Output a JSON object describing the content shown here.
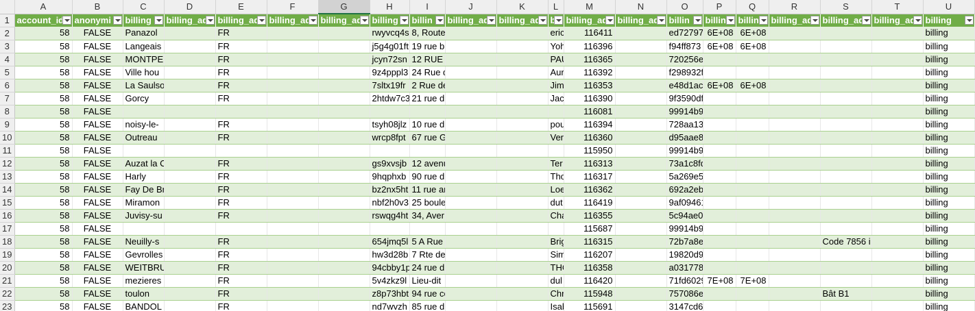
{
  "column_letters": [
    "A",
    "B",
    "C",
    "D",
    "E",
    "F",
    "G",
    "H",
    "I",
    "J",
    "K",
    "L",
    "M",
    "N",
    "O",
    "P",
    "Q",
    "R",
    "S",
    "T",
    "U"
  ],
  "selected_column": "G",
  "header_row_number": "1",
  "headers": [
    "account_id",
    "anonymi",
    "billing",
    "billing_ad",
    "billing_ad",
    "billing_ad",
    "billing_ad",
    "billing",
    "billin",
    "billing_ad",
    "billing_ad",
    "b",
    "billing_ad",
    "billing_ad",
    "billin",
    "billin",
    "billin",
    "billing_ad",
    "billing_ad",
    "billing_ad",
    "billing"
  ],
  "rows": [
    {
      "n": "2",
      "cells": [
        "58",
        "FALSE",
        "Panazol",
        "",
        "FR",
        "",
        "",
        "rwyvcq4s",
        "8, Route",
        "",
        "",
        "eric",
        "116411",
        "",
        "ed72797",
        "6E+08",
        "6E+08",
        "",
        "",
        "",
        "billing"
      ]
    },
    {
      "n": "3",
      "cells": [
        "58",
        "FALSE",
        "Langeais",
        "",
        "FR",
        "",
        "",
        "j5g4g01ft",
        "19 rue b",
        "",
        "",
        "Yoh",
        "116396",
        "",
        "f94ff873",
        "6E+08",
        "6E+08",
        "",
        "",
        "",
        "billing"
      ]
    },
    {
      "n": "4",
      "cells": [
        "58",
        "FALSE",
        "MONTPEI",
        "",
        "FR",
        "",
        "",
        "jcyn72sn",
        "12 RUE D",
        "",
        "",
        "PAU",
        "116365",
        "",
        "720256e383f431a653c0b4",
        "",
        "",
        "",
        "",
        "",
        "billing"
      ]
    },
    {
      "n": "5",
      "cells": [
        "58",
        "FALSE",
        "Ville hou",
        "",
        "FR",
        "",
        "",
        "9z4pppl3",
        "24 Rue d",
        "",
        "",
        "Aur",
        "116392",
        "",
        "f298932f3ea65833d1e4c3",
        "",
        "",
        "",
        "",
        "",
        "billing"
      ]
    },
    {
      "n": "6",
      "cells": [
        "58",
        "FALSE",
        "La Saulso",
        "",
        "FR",
        "",
        "",
        "7sltx19fr",
        "2 Rue de",
        "",
        "",
        "Jim",
        "116353",
        "",
        "e48d1ac",
        "6E+08",
        "6E+08",
        "",
        "",
        "",
        "billing"
      ]
    },
    {
      "n": "7",
      "cells": [
        "58",
        "FALSE",
        "Gorcy",
        "",
        "FR",
        "",
        "",
        "2htdw7c3",
        "21 rue d",
        "",
        "",
        "Jacc",
        "116390",
        "",
        "9f3590df310b5006044e8",
        "",
        "",
        "",
        "",
        "",
        "billing"
      ]
    },
    {
      "n": "8",
      "cells": [
        "58",
        "FALSE",
        "",
        "",
        "",
        "",
        "",
        "",
        "",
        "",
        "",
        "",
        "116081",
        "",
        "99914b932bd37a50b983c",
        "",
        "",
        "",
        "",
        "",
        "billing"
      ]
    },
    {
      "n": "9",
      "cells": [
        "58",
        "FALSE",
        "noisy-le-",
        "",
        "FR",
        "",
        "",
        "tsyh08jlz",
        "10 rue d",
        "",
        "",
        "pou",
        "116394",
        "",
        "728aa13ba530f2f78f597b",
        "",
        "",
        "",
        "",
        "",
        "billing"
      ]
    },
    {
      "n": "10",
      "cells": [
        "58",
        "FALSE",
        "Outreau",
        "",
        "FR",
        "",
        "",
        "wrcp8fpt",
        "67 rue G",
        "",
        "",
        "Ver",
        "116360",
        "",
        "d95aae829e93e7253c951",
        "",
        "",
        "",
        "",
        "",
        "billing"
      ]
    },
    {
      "n": "11",
      "cells": [
        "58",
        "FALSE",
        "",
        "",
        "",
        "",
        "",
        "",
        "",
        "",
        "",
        "",
        "115950",
        "",
        "99914b932bd37a50b983c",
        "",
        "",
        "",
        "",
        "",
        "billing"
      ]
    },
    {
      "n": "12",
      "cells": [
        "58",
        "FALSE",
        "Auzat la C",
        "",
        "FR",
        "",
        "",
        "gs9xvsjb",
        "12 avenu",
        "",
        "",
        "Ter",
        "116313",
        "",
        "73a1c8fda442ea885d30a",
        "",
        "",
        "",
        "",
        "",
        "billing"
      ]
    },
    {
      "n": "13",
      "cells": [
        "58",
        "FALSE",
        "Harly",
        "",
        "FR",
        "",
        "",
        "9hqphxb",
        "90 rue d",
        "",
        "",
        "Tho",
        "116317",
        "",
        "5a269e5bf18c2018cc034c",
        "",
        "",
        "",
        "",
        "",
        "billing"
      ]
    },
    {
      "n": "14",
      "cells": [
        "58",
        "FALSE",
        "Fay De Br",
        "",
        "FR",
        "",
        "",
        "bz2nx5ht",
        "11 rue ar",
        "",
        "",
        "Loe",
        "116362",
        "",
        "692a2eb445ad6035abdf9",
        "",
        "",
        "",
        "",
        "",
        "billing"
      ]
    },
    {
      "n": "15",
      "cells": [
        "58",
        "FALSE",
        "Miramon",
        "",
        "FR",
        "",
        "",
        "nbf2h0v3",
        "25 boule",
        "",
        "",
        "dut",
        "116419",
        "",
        "9af094614ff684b58276ad",
        "",
        "",
        "",
        "",
        "",
        "billing"
      ]
    },
    {
      "n": "16",
      "cells": [
        "58",
        "FALSE",
        "Juvisy-su",
        "",
        "FR",
        "",
        "",
        "rswqg4ht",
        "34, Aver",
        "",
        "",
        "Cha",
        "116355",
        "",
        "5c94ae0859a84a298dfba",
        "",
        "",
        "",
        "",
        "",
        "billing"
      ]
    },
    {
      "n": "17",
      "cells": [
        "58",
        "FALSE",
        "",
        "",
        "",
        "",
        "",
        "",
        "",
        "",
        "",
        "",
        "115687",
        "",
        "99914b932bd37a50b983c",
        "",
        "",
        "",
        "",
        "",
        "billing"
      ]
    },
    {
      "n": "18",
      "cells": [
        "58",
        "FALSE",
        "Neuilly-s",
        "",
        "FR",
        "",
        "",
        "654jmq5l",
        "5 A Rue",
        "",
        "",
        "Brig",
        "116315",
        "",
        "72b7a8e2417f9238bd275",
        "",
        "",
        "",
        "Code 7856 i",
        "",
        "billing"
      ]
    },
    {
      "n": "19",
      "cells": [
        "58",
        "FALSE",
        "Gevrolles",
        "",
        "FR",
        "",
        "",
        "hw3d28b",
        "7 Rte de",
        "",
        "",
        "Sim",
        "116207",
        "",
        "19820d9bef00161cceb49",
        "",
        "",
        "",
        "",
        "",
        "billing"
      ]
    },
    {
      "n": "20",
      "cells": [
        "58",
        "FALSE",
        "WEITBRU",
        "",
        "FR",
        "",
        "",
        "94cbby1p",
        "24 rue d",
        "",
        "",
        "THC",
        "116358",
        "",
        "a0317786399db52b880f9",
        "",
        "",
        "",
        "",
        "",
        "billing"
      ]
    },
    {
      "n": "21",
      "cells": [
        "58",
        "FALSE",
        "mezieres",
        "",
        "FR",
        "",
        "",
        "5v4zkz9l",
        "Lieu-dit",
        "",
        "",
        "dul",
        "116420",
        "",
        "71fd6029",
        "7E+08",
        "7E+08",
        "",
        "",
        "",
        "billing"
      ]
    },
    {
      "n": "22",
      "cells": [
        "58",
        "FALSE",
        "toulon",
        "",
        "FR",
        "",
        "",
        "z8p73hbt",
        "94 rue co",
        "",
        "",
        "Chr",
        "115948",
        "",
        "757086e6d34e60cb0f2c4",
        "",
        "",
        "",
        "Bât B1",
        "",
        "billing"
      ]
    },
    {
      "n": "23",
      "cells": [
        "58",
        "FALSE",
        "BANDOL",
        "",
        "FR",
        "",
        "",
        "nd7wvzh",
        "85 rue d",
        "",
        "",
        "Isab",
        "115691",
        "",
        "3147cd615c9f6ca2ddd10",
        "",
        "",
        "",
        "",
        "",
        "billing"
      ]
    }
  ],
  "colors": {
    "header_green": "#70ad47",
    "band_green": "#e2efda",
    "grid_line": "#a9d08e"
  }
}
